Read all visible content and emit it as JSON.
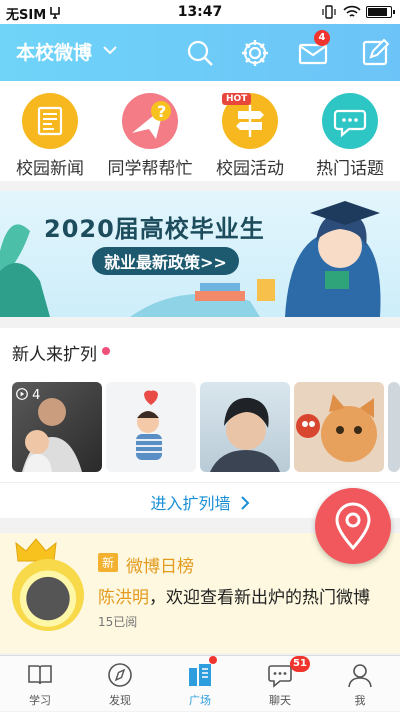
{
  "status_bar": {
    "carrier": "无SIM",
    "time": "13:47"
  },
  "header": {
    "title": "本校微博",
    "mail_badge": "4",
    "icons": [
      "search-icon",
      "settings-icon",
      "mail-icon",
      "compose-icon"
    ],
    "bg_color": "#6fd4f8"
  },
  "quick_nav": [
    {
      "label": "校园新闻",
      "icon": "newspaper-icon",
      "color": "#f7b81f"
    },
    {
      "label": "同学帮帮忙",
      "icon": "help-icon",
      "color": "#f47c86"
    },
    {
      "label": "校园活动",
      "icon": "signpost-icon",
      "color": "#f7b81f",
      "tag": "HOT"
    },
    {
      "label": "热门话题",
      "icon": "chat-bubble-icon",
      "color": "#2ec6c4"
    }
  ],
  "banner": {
    "title": "2020届高校毕业生",
    "subtitle": "就业最新政策>>"
  },
  "new_people": {
    "title": "新人来扩列",
    "video_badge": "4",
    "link": "进入扩列墙",
    "photos": [
      "family-photo",
      "child-photo",
      "man-portrait-photo",
      "cat-photo"
    ]
  },
  "hot_weibo": {
    "tag": "新",
    "title": "微博日榜",
    "name": "陈洪明",
    "text": "，欢迎查看新出炉的热门微博",
    "meta": "15已阅"
  },
  "tab_bar": {
    "active_index": 2,
    "chat_badge": "51",
    "tabs": [
      {
        "label": "学习",
        "icon": "book-icon"
      },
      {
        "label": "发现",
        "icon": "compass-icon"
      },
      {
        "label": "广场",
        "icon": "building-icon"
      },
      {
        "label": "聊天",
        "icon": "chat-icon"
      },
      {
        "label": "我",
        "icon": "person-icon"
      }
    ]
  },
  "colors": {
    "accent": "#2e9ddd",
    "fab": "#f0585d",
    "badge": "#f0342e"
  }
}
